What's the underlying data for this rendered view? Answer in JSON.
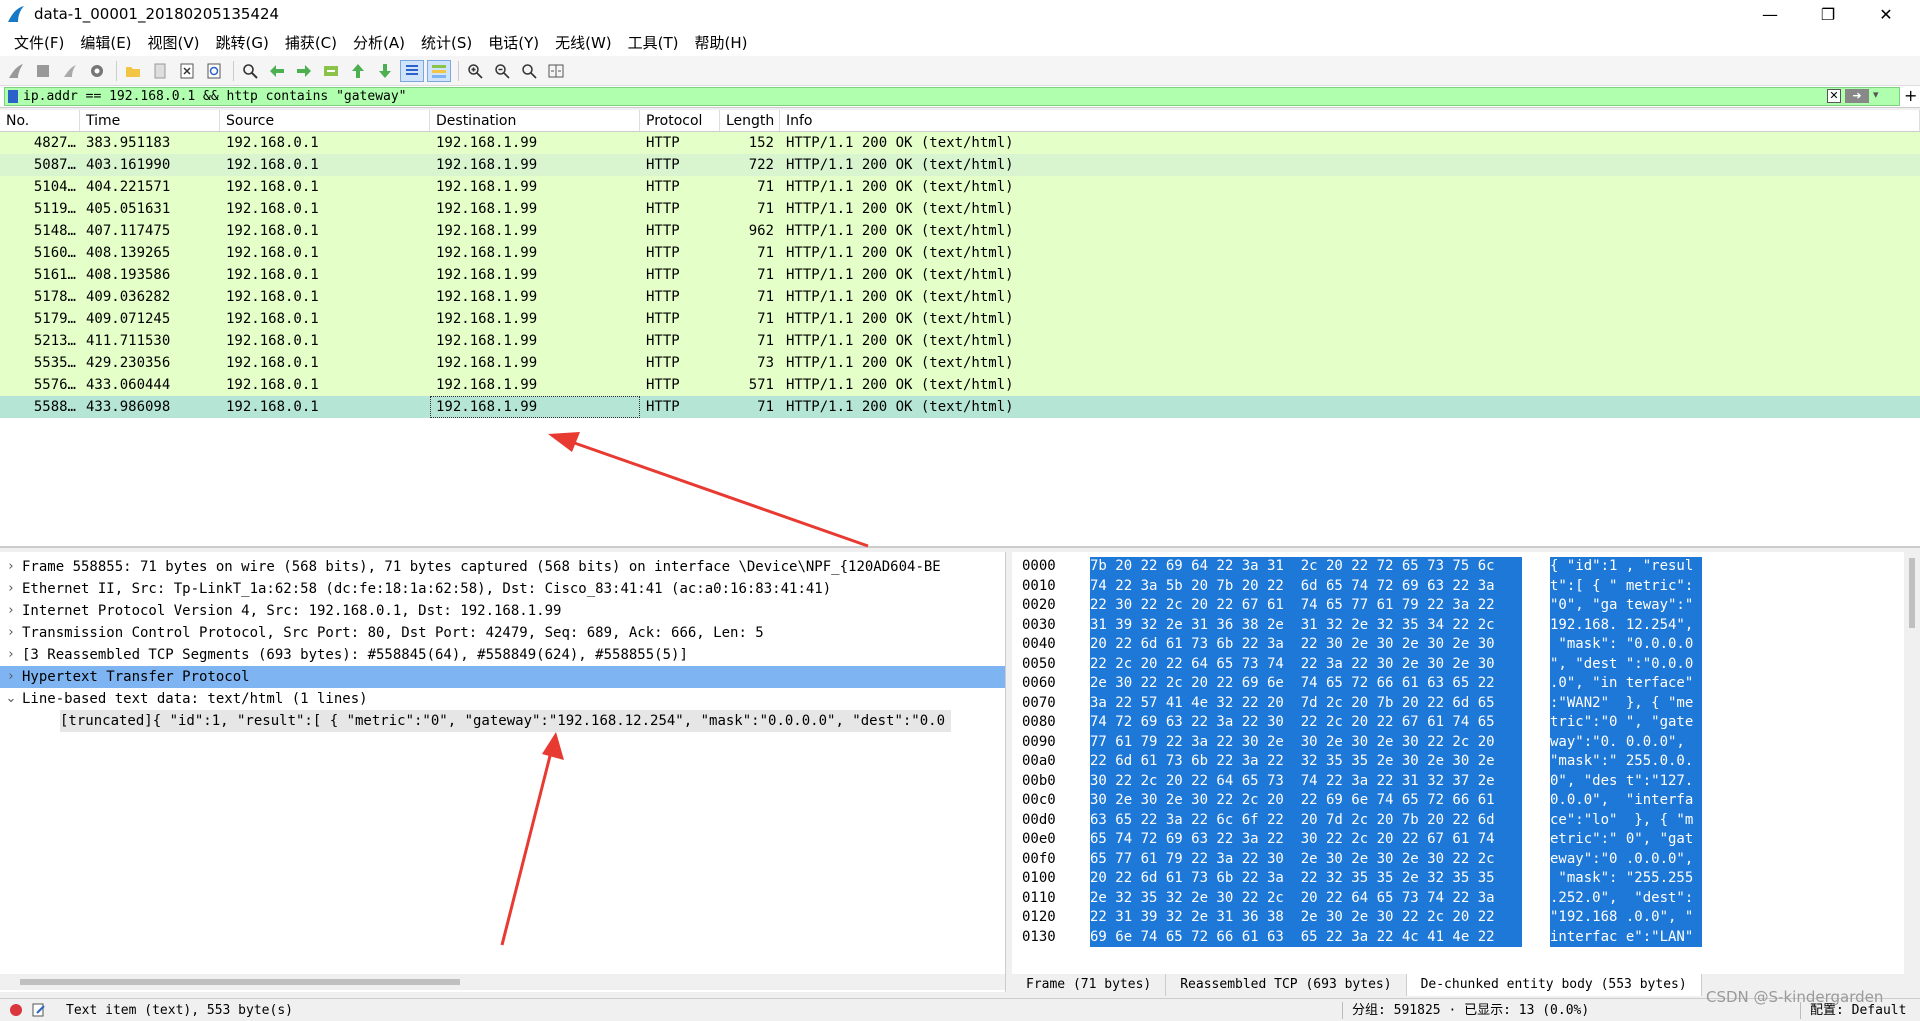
{
  "window": {
    "title": "data-1_00001_20180205135424"
  },
  "menu": [
    "文件(F)",
    "编辑(E)",
    "视图(V)",
    "跳转(G)",
    "捕获(C)",
    "分析(A)",
    "统计(S)",
    "电话(Y)",
    "无线(W)",
    "工具(T)",
    "帮助(H)"
  ],
  "filter": {
    "value": "ip.addr == 192.168.0.1 && http contains \"gateway\""
  },
  "packet_list": {
    "columns": [
      "No.",
      "Time",
      "Source",
      "Destination",
      "Protocol",
      "Length",
      "Info"
    ],
    "rows": [
      {
        "no": "4827…",
        "time": "383.951183",
        "src": "192.168.0.1",
        "dst": "192.168.1.99",
        "proto": "HTTP",
        "len": "152",
        "info": "HTTP/1.1 200 OK  (text/html)"
      },
      {
        "no": "5087…",
        "time": "403.161990",
        "src": "192.168.0.1",
        "dst": "192.168.1.99",
        "proto": "HTTP",
        "len": "722",
        "info": "HTTP/1.1 200 OK  (text/html)"
      },
      {
        "no": "5104…",
        "time": "404.221571",
        "src": "192.168.0.1",
        "dst": "192.168.1.99",
        "proto": "HTTP",
        "len": "71",
        "info": "HTTP/1.1 200 OK  (text/html)"
      },
      {
        "no": "5119…",
        "time": "405.051631",
        "src": "192.168.0.1",
        "dst": "192.168.1.99",
        "proto": "HTTP",
        "len": "71",
        "info": "HTTP/1.1 200 OK  (text/html)"
      },
      {
        "no": "5148…",
        "time": "407.117475",
        "src": "192.168.0.1",
        "dst": "192.168.1.99",
        "proto": "HTTP",
        "len": "962",
        "info": "HTTP/1.1 200 OK  (text/html)"
      },
      {
        "no": "5160…",
        "time": "408.139265",
        "src": "192.168.0.1",
        "dst": "192.168.1.99",
        "proto": "HTTP",
        "len": "71",
        "info": "HTTP/1.1 200 OK  (text/html)"
      },
      {
        "no": "5161…",
        "time": "408.193586",
        "src": "192.168.0.1",
        "dst": "192.168.1.99",
        "proto": "HTTP",
        "len": "71",
        "info": "HTTP/1.1 200 OK  (text/html)"
      },
      {
        "no": "5178…",
        "time": "409.036282",
        "src": "192.168.0.1",
        "dst": "192.168.1.99",
        "proto": "HTTP",
        "len": "71",
        "info": "HTTP/1.1 200 OK  (text/html)"
      },
      {
        "no": "5179…",
        "time": "409.071245",
        "src": "192.168.0.1",
        "dst": "192.168.1.99",
        "proto": "HTTP",
        "len": "71",
        "info": "HTTP/1.1 200 OK  (text/html)"
      },
      {
        "no": "5213…",
        "time": "411.711530",
        "src": "192.168.0.1",
        "dst": "192.168.1.99",
        "proto": "HTTP",
        "len": "71",
        "info": "HTTP/1.1 200 OK  (text/html)"
      },
      {
        "no": "5535…",
        "time": "429.230356",
        "src": "192.168.0.1",
        "dst": "192.168.1.99",
        "proto": "HTTP",
        "len": "73",
        "info": "HTTP/1.1 200 OK  (text/html)"
      },
      {
        "no": "5576…",
        "time": "433.060444",
        "src": "192.168.0.1",
        "dst": "192.168.1.99",
        "proto": "HTTP",
        "len": "571",
        "info": "HTTP/1.1 200 OK  (text/html)"
      },
      {
        "no": "5588…",
        "time": "433.986098",
        "src": "192.168.0.1",
        "dst": "192.168.1.99",
        "proto": "HTTP",
        "len": "71",
        "info": "HTTP/1.1 200 OK  (text/html)"
      }
    ]
  },
  "details": {
    "lines": [
      "Frame 558855: 71 bytes on wire (568 bits), 71 bytes captured (568 bits) on interface \\Device\\NPF_{120AD604-BE",
      "Ethernet II, Src: Tp-LinkT_1a:62:58 (dc:fe:18:1a:62:58), Dst: Cisco_83:41:41 (ac:a0:16:83:41:41)",
      "Internet Protocol Version 4, Src: 192.168.0.1, Dst: 192.168.1.99",
      "Transmission Control Protocol, Src Port: 80, Dst Port: 42479, Seq: 689, Ack: 666, Len: 5",
      "[3 Reassembled TCP Segments (693 bytes): #558845(64), #558849(624), #558855(5)]",
      "Hypertext Transfer Protocol",
      "Line-based text data: text/html (1 lines)"
    ],
    "sub_line": "[truncated]{ \"id\":1, \"result\":[ { \"metric\":\"0\", \"gateway\":\"192.168.12.254\", \"mask\":\"0.0.0.0\", \"dest\":\"0.0"
  },
  "bytes": {
    "rows": [
      {
        "off": "0000",
        "hex": "7b 20 22 69 64 22 3a 31  2c 20 22 72 65 73 75 6c",
        "ascii": "{ \"id\":1 , \"resul"
      },
      {
        "off": "0010",
        "hex": "74 22 3a 5b 20 7b 20 22  6d 65 74 72 69 63 22 3a",
        "ascii": "t\":[ { \" metric\":"
      },
      {
        "off": "0020",
        "hex": "22 30 22 2c 20 22 67 61  74 65 77 61 79 22 3a 22",
        "ascii": "\"0\", \"ga teway\":\""
      },
      {
        "off": "0030",
        "hex": "31 39 32 2e 31 36 38 2e  31 32 2e 32 35 34 22 2c",
        "ascii": "192.168. 12.254\","
      },
      {
        "off": "0040",
        "hex": "20 22 6d 61 73 6b 22 3a  22 30 2e 30 2e 30 2e 30",
        "ascii": " \"mask\": \"0.0.0.0"
      },
      {
        "off": "0050",
        "hex": "22 2c 20 22 64 65 73 74  22 3a 22 30 2e 30 2e 30",
        "ascii": "\", \"dest \":\"0.0.0"
      },
      {
        "off": "0060",
        "hex": "2e 30 22 2c 20 22 69 6e  74 65 72 66 61 63 65 22",
        "ascii": ".0\", \"in terface\""
      },
      {
        "off": "0070",
        "hex": "3a 22 57 41 4e 32 22 20  7d 2c 20 7b 20 22 6d 65",
        "ascii": ":\"WAN2\"  }, { \"me"
      },
      {
        "off": "0080",
        "hex": "74 72 69 63 22 3a 22 30  22 2c 20 22 67 61 74 65",
        "ascii": "tric\":\"0 \", \"gate"
      },
      {
        "off": "0090",
        "hex": "77 61 79 22 3a 22 30 2e  30 2e 30 2e 30 22 2c 20",
        "ascii": "way\":\"0. 0.0.0\", "
      },
      {
        "off": "00a0",
        "hex": "22 6d 61 73 6b 22 3a 22  32 35 35 2e 30 2e 30 2e",
        "ascii": "\"mask\":\" 255.0.0."
      },
      {
        "off": "00b0",
        "hex": "30 22 2c 20 22 64 65 73  74 22 3a 22 31 32 37 2e",
        "ascii": "0\", \"des t\":\"127."
      },
      {
        "off": "00c0",
        "hex": "30 2e 30 2e 30 22 2c 20  22 69 6e 74 65 72 66 61",
        "ascii": "0.0.0\",  \"interfa"
      },
      {
        "off": "00d0",
        "hex": "63 65 22 3a 22 6c 6f 22  20 7d 2c 20 7b 20 22 6d",
        "ascii": "ce\":\"lo\"  }, { \"m"
      },
      {
        "off": "00e0",
        "hex": "65 74 72 69 63 22 3a 22  30 22 2c 20 22 67 61 74",
        "ascii": "etric\":\" 0\", \"gat"
      },
      {
        "off": "00f0",
        "hex": "65 77 61 79 22 3a 22 30  2e 30 2e 30 2e 30 22 2c",
        "ascii": "eway\":\"0 .0.0.0\","
      },
      {
        "off": "0100",
        "hex": "20 22 6d 61 73 6b 22 3a  22 32 35 35 2e 32 35 35",
        "ascii": " \"mask\": \"255.255"
      },
      {
        "off": "0110",
        "hex": "2e 32 35 32 2e 30 22 2c  20 22 64 65 73 74 22 3a",
        "ascii": ".252.0\",  \"dest\":"
      },
      {
        "off": "0120",
        "hex": "22 31 39 32 2e 31 36 38  2e 30 2e 30 22 2c 20 22",
        "ascii": "\"192.168 .0.0\", \""
      },
      {
        "off": "0130",
        "hex": "69 6e 74 65 72 66 61 63  65 22 3a 22 4c 41 4e 22",
        "ascii": "interfac e\":\"LAN\""
      }
    ],
    "tabs": [
      "Frame (71 bytes)",
      "Reassembled TCP (693 bytes)",
      "De-chunked entity body (553 bytes)"
    ]
  },
  "status": {
    "left": "Text item (text), 553 byte(s)",
    "right": "分组: 591825 · 已显示: 13 (0.0%)",
    "profile": "配置: Default"
  },
  "watermark": "CSDN @S-kindergarden",
  "colors": {
    "row_green": "#e4ffc7",
    "row_selected": "#b5e6d5",
    "highlight_blue": "#7fb4f2",
    "byte_select": "#1e78d7",
    "filter_bg": "#afffaf",
    "arrow": "#e83a30"
  }
}
